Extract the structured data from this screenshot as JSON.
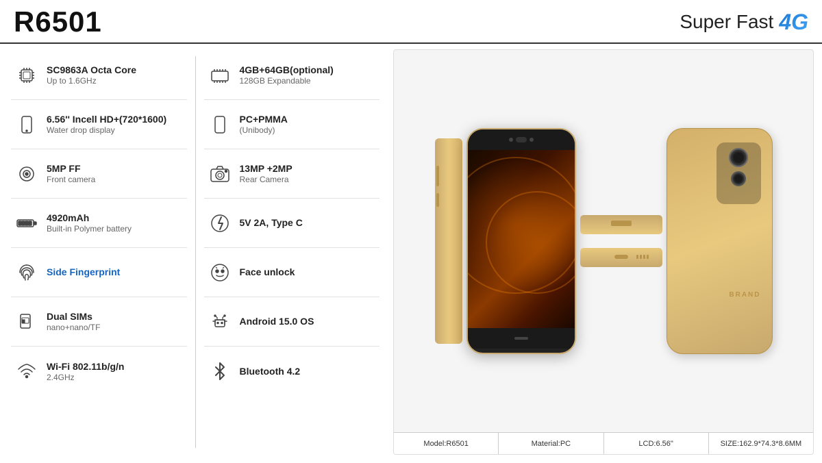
{
  "header": {
    "title": "R6501",
    "super_fast_label": "Super Fast",
    "badge_4g": "4G"
  },
  "specs_left": [
    {
      "icon": "cpu-icon",
      "main": "SC9863A Octa Core",
      "sub": "Up to 1.6GHz"
    },
    {
      "icon": "display-icon",
      "main": "6.56'' Incell HD+(720*1600)",
      "sub": "Water drop display"
    },
    {
      "icon": "camera-front-icon",
      "main": "5MP FF",
      "sub": "Front camera"
    },
    {
      "icon": "battery-icon",
      "main": "4920mAh",
      "sub": "Built-in Polymer battery"
    },
    {
      "icon": "fingerprint-icon",
      "main": "Side Fingerprint",
      "sub": "",
      "highlight": true
    },
    {
      "icon": "sim-icon",
      "main": "Dual SIMs",
      "sub": "nano+nano/TF"
    },
    {
      "icon": "wifi-icon",
      "main": "Wi-Fi 802.11b/g/n",
      "sub": "2.4GHz"
    }
  ],
  "specs_right": [
    {
      "icon": "ram-icon",
      "main": "4GB+64GB(optional)",
      "sub": "128GB Expandable"
    },
    {
      "icon": "body-icon",
      "main": "PC+PMMA",
      "sub": "(Unibody)"
    },
    {
      "icon": "camera-rear-icon",
      "main": "13MP +2MP",
      "sub": "Rear Camera"
    },
    {
      "icon": "charging-icon",
      "main": "5V 2A, Type C",
      "sub": ""
    },
    {
      "icon": "face-unlock-icon",
      "main": "Face unlock",
      "sub": ""
    },
    {
      "icon": "android-icon",
      "main": "Android 15.0 OS",
      "sub": ""
    },
    {
      "icon": "bluetooth-icon",
      "main": "Bluetooth 4.2",
      "sub": ""
    }
  ],
  "footer": {
    "model": "Model:R6501",
    "material": "Material:PC",
    "lcd": "LCD:6.56\"",
    "size": "SIZE:162.9*74.3*8.6MM"
  }
}
